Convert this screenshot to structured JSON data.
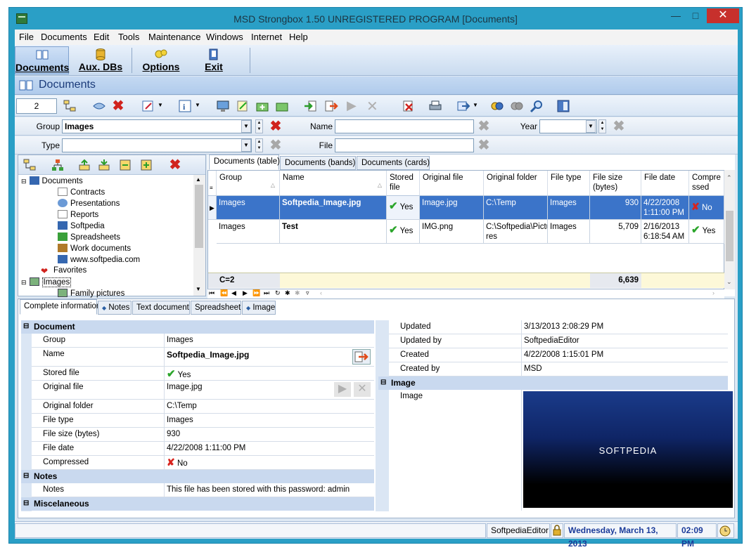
{
  "window": {
    "title": "MSD Strongbox 1.50 UNREGISTERED PROGRAM [Documents]"
  },
  "menu": [
    "File",
    "Documents",
    "Edit",
    "Tools",
    "Maintenance",
    "Windows",
    "Internet",
    "Help"
  ],
  "bigtools": {
    "documents": "Documents",
    "auxdbs": "Aux. DBs",
    "options": "Options",
    "exit": "Exit"
  },
  "section": {
    "title": "Documents"
  },
  "toolbar": {
    "counter": "2"
  },
  "filters": {
    "group_label": "Group",
    "group_value": "Images",
    "name_label": "Name",
    "name_value": "",
    "year_label": "Year",
    "year_value": "",
    "type_label": "Type",
    "type_value": "",
    "file_label": "File",
    "file_value": ""
  },
  "tree": {
    "items": [
      {
        "label": "Documents"
      },
      {
        "label": "Contracts"
      },
      {
        "label": "Presentations"
      },
      {
        "label": "Reports"
      },
      {
        "label": "Softpedia"
      },
      {
        "label": "Spreadsheets"
      },
      {
        "label": "Work documents"
      },
      {
        "label": "www.softpedia.com"
      },
      {
        "label": "Favorites"
      },
      {
        "label": "Images"
      },
      {
        "label": "Family pictures"
      }
    ]
  },
  "grid": {
    "tabs": [
      "Documents (table)",
      "Documents (bands)",
      "Documents (cards)"
    ],
    "columns": [
      "Group",
      "Name",
      "Stored file",
      "Original file",
      "Original folder",
      "File type",
      "File size (bytes)",
      "File date",
      "Compressed"
    ],
    "col_heads": {
      "group": "Group",
      "name": "Name",
      "stored1": "Stored",
      "stored2": "file",
      "orig_file": "Original file",
      "orig_folder": "Original folder",
      "file_type": "File type",
      "size1": "File size",
      "size2": "(bytes)",
      "date": "File date",
      "comp1": "Compre",
      "comp2": "ssed"
    },
    "rows": [
      {
        "group": "Images",
        "name": "Softpedia_Image.jpg",
        "stored": "Yes",
        "orig_file": "Image.jpg",
        "orig_folder": "C:\\Temp",
        "folder2": "",
        "file_type": "Images",
        "size": "930",
        "date1": "4/22/2008",
        "date2": "1:11:00 PM",
        "compressed": "No"
      },
      {
        "group": "Images",
        "name": "Test",
        "stored": "Yes",
        "orig_file": "IMG.png",
        "orig_folder": "C:\\Softpedia\\Pictu",
        "folder2": "res",
        "file_type": "Images",
        "size": "5,709",
        "date1": "2/16/2013",
        "date2": "6:18:54 AM",
        "compressed": "Yes"
      }
    ],
    "footer_count": "C=2",
    "footer_total": "6,639"
  },
  "lower_tabs": [
    "Complete information",
    "Notes",
    "Text document",
    "Spreadsheet",
    "Image"
  ],
  "props_left": {
    "cat_document": "Document",
    "group_n": "Group",
    "group_v": "Images",
    "name_n": "Name",
    "name_v": "Softpedia_Image.jpg",
    "stored_n": "Stored file",
    "stored_v": "Yes",
    "origfile_n": "Original file",
    "origfile_v": "Image.jpg",
    "origfolder_n": "Original folder",
    "origfolder_v": "C:\\Temp",
    "filetype_n": "File type",
    "filetype_v": "Images",
    "size_n": "File size (bytes)",
    "size_v": "930",
    "date_n": "File date",
    "date_v": "4/22/2008 1:11:00 PM",
    "comp_n": "Compressed",
    "comp_v": "No",
    "cat_notes": "Notes",
    "notes_n": "Notes",
    "notes_v": "This file has been stored with this password: admin",
    "cat_misc": "Miscelaneous"
  },
  "props_right": {
    "updated_n": "Updated",
    "updated_v": "3/13/2013 2:08:29 PM",
    "updatedby_n": "Updated by",
    "updatedby_v": "SoftpediaEditor",
    "created_n": "Created",
    "created_v": "4/22/2008 1:15:01 PM",
    "createdby_n": "Created by",
    "createdby_v": "MSD",
    "cat_image": "Image",
    "image_n": "Image",
    "image_brand": "SOFTPEDIA"
  },
  "status": {
    "user": "SoftpediaEditor",
    "date": "Wednesday, March 13, 2013",
    "time": "02:09 PM"
  }
}
